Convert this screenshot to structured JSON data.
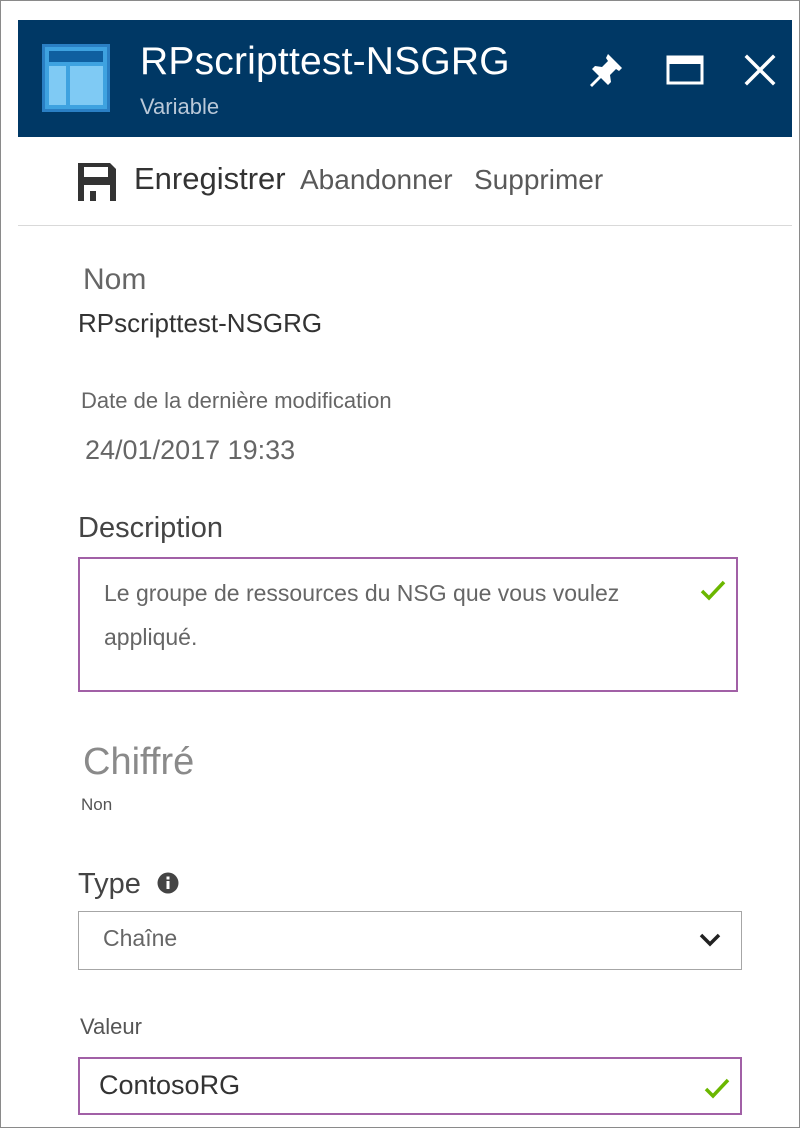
{
  "header": {
    "title": "RPscripttest-NSGRG",
    "subtitle": "Variable",
    "icon": "variable-blade-icon",
    "background_color": "#003865"
  },
  "commands": {
    "save_label": "Enregistrer",
    "discard_label": "Abandonner",
    "delete_label": "Supprimer"
  },
  "fields": {
    "name": {
      "label": "Nom",
      "value": "RPscripttest-NSGRG"
    },
    "last_modified": {
      "label": "Date de la dernière modification",
      "value": "24/01/2017 19:33"
    },
    "description": {
      "label": "Description",
      "value": "Le groupe de ressources du NSG que vous voulez appliqué."
    },
    "encrypted": {
      "label": "Chiffré",
      "value": "Non"
    },
    "type": {
      "label": "Type",
      "selected": "Chaîne"
    },
    "value": {
      "label": "Valeur",
      "value": "ContosoRG"
    }
  },
  "colors": {
    "focus_border": "#a160a6",
    "valid_check": "#6bb700"
  }
}
